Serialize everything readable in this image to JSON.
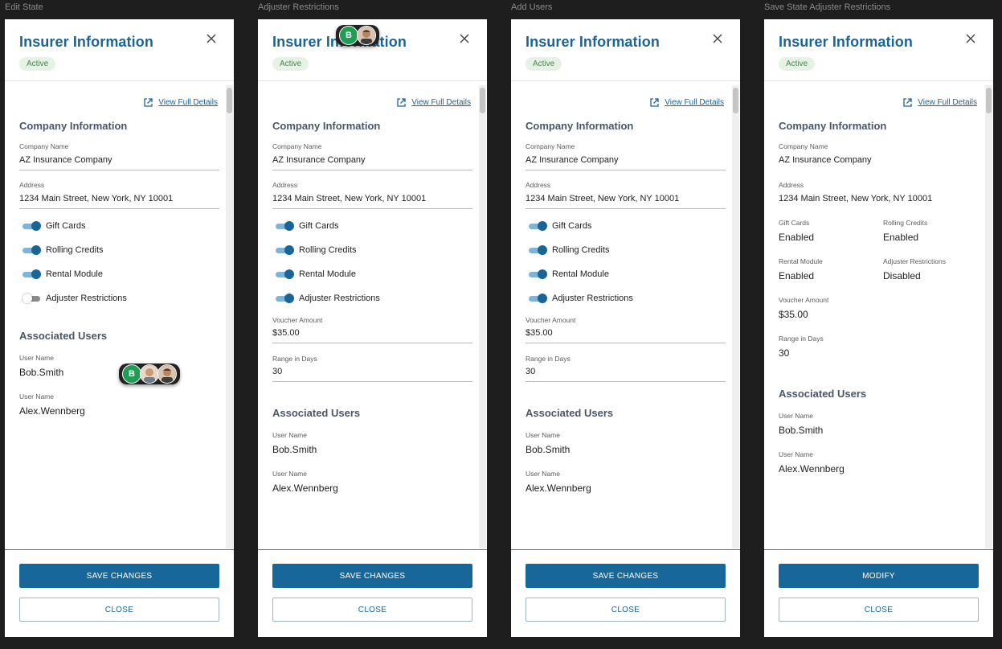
{
  "frames": [
    {
      "id": "edit",
      "label": "Edit State"
    },
    {
      "id": "adjuster",
      "label": "Adjuster Restrictions"
    },
    {
      "id": "add",
      "label": "Add Users"
    },
    {
      "id": "save",
      "label": "Save State Adjuster Restrictions"
    }
  ],
  "panel": {
    "title": "Insurer Information",
    "status": "Active",
    "view_details": "View Full Details",
    "company_section": "Company Information",
    "company_name_label": "Company Name",
    "company_name": "AZ Insurance Company",
    "address_label": "Address",
    "address": "1234 Main Street, New York, NY 10001",
    "toggles": {
      "gift_cards": "Gift Cards",
      "rolling_credits": "Rolling Credits",
      "rental_module": "Rental Module",
      "adjuster_restrictions": "Adjuster Restrictions"
    },
    "voucher_label": "Voucher Amount",
    "voucher_value": "$35.00",
    "range_label": "Range in Days",
    "range_value": "30",
    "users_section": "Associated Users",
    "user_label": "User Name",
    "users": [
      "Bob.Smith",
      "Alex.Wennberg"
    ],
    "save_button": "SAVE CHANGES",
    "modify_button": "MODIFY",
    "close_button": "CLOSE"
  },
  "readonly": {
    "gift_cards": {
      "label": "Gift Cards",
      "value": "Enabled"
    },
    "rolling_credits": {
      "label": "Rolling Credits",
      "value": "Enabled"
    },
    "rental_module": {
      "label": "Rental Module",
      "value": "Enabled"
    },
    "adjuster_restrictions": {
      "label": "Adjuster Restrictions",
      "value": "Disabled"
    }
  },
  "cursor_initial": "B",
  "colors": {
    "accent": "#17679a",
    "badge_bg": "#e6f2e6",
    "badge_text": "#3f8a45",
    "canvas": "#1e1e1e"
  },
  "icons": {
    "close": "close-icon",
    "external_link": "external-link-icon",
    "avatar": "avatar-icon"
  }
}
